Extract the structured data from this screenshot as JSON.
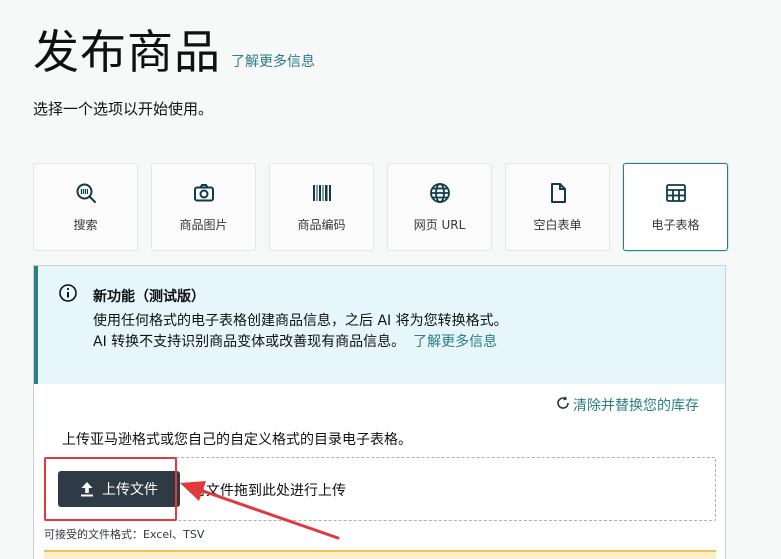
{
  "header": {
    "title": "发布商品",
    "learn_more": "了解更多信息"
  },
  "subtitle": "选择一个选项以开始使用。",
  "options": [
    {
      "label": "搜索",
      "icon": "search-barcode-icon",
      "selected": false
    },
    {
      "label": "商品图片",
      "icon": "camera-icon",
      "selected": false
    },
    {
      "label": "商品编码",
      "icon": "barcode-icon",
      "selected": false
    },
    {
      "label": "网页 URL",
      "icon": "globe-icon",
      "selected": false
    },
    {
      "label": "空白表单",
      "icon": "document-icon",
      "selected": false
    },
    {
      "label": "电子表格",
      "icon": "spreadsheet-icon",
      "selected": true
    }
  ],
  "banner": {
    "icon": "info-icon",
    "title": "新功能（测试版）",
    "line1": "使用任何格式的电子表格创建商品信息，之后 AI 将为您转换格式。",
    "line2": "AI 转换不支持识别商品变体或改善现有商品信息。",
    "link": "了解更多信息"
  },
  "upload": {
    "clear_link": "清除并替换您的库存",
    "description": "上传亚马逊格式或您自己的自定义格式的目录电子表格。",
    "button_label": "上传文件",
    "drop_text": "将文件拖到此处进行上传",
    "accepted_formats": "可接受的文件格式：Excel、TSV"
  },
  "colors": {
    "accent": "#2a7d89",
    "highlight": "#e0393e",
    "banner_bg": "#e6f6fb",
    "button_bg": "#2f3b44"
  }
}
